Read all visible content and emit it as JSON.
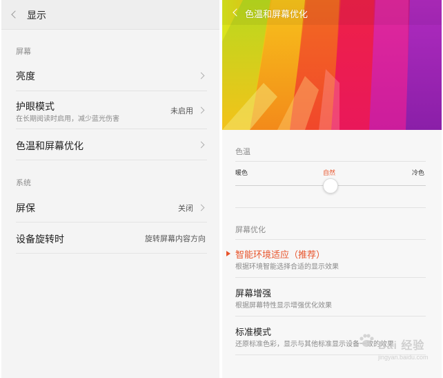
{
  "left_screen": {
    "header": {
      "title": "显示"
    },
    "sections": [
      {
        "label": "屏幕",
        "items": [
          {
            "title": "亮度",
            "subtitle": "",
            "value": ""
          },
          {
            "title": "护眼模式",
            "subtitle": "在长期阅读时启用，减少蓝光伤害",
            "value": "未启用"
          },
          {
            "title": "色温和屏幕优化",
            "subtitle": "",
            "value": ""
          }
        ]
      },
      {
        "label": "系统",
        "items": [
          {
            "title": "屏保",
            "subtitle": "",
            "value": "关闭"
          },
          {
            "title": "设备旋转时",
            "subtitle": "",
            "value": "旋转屏幕内容方向"
          }
        ]
      }
    ]
  },
  "right_screen": {
    "header": {
      "title": "色温和屏幕优化"
    },
    "color_temp": {
      "label": "色温",
      "warm_label": "暖色",
      "natural_label": "自然",
      "cool_label": "冷色",
      "value": 0.5,
      "accent": "#e8542b"
    },
    "optimization": {
      "label": "屏幕优化",
      "options": [
        {
          "title": "智能环境适应（推荐）",
          "subtitle": "根据环境智能选择合适的显示效果",
          "selected": true
        },
        {
          "title": "屏幕增强",
          "subtitle": "根据屏幕特性显示增强优化效果",
          "selected": false
        },
        {
          "title": "标准模式",
          "subtitle": "还原标准色彩，显示与其他标准显示设备一致的效果",
          "selected": false
        }
      ]
    }
  },
  "watermark": {
    "text": "Bai 经验",
    "url": "jingyan.baidu.com"
  },
  "colors": {
    "accent": "#e8542b",
    "text": "#222222",
    "secondary": "#8a8a8a"
  }
}
